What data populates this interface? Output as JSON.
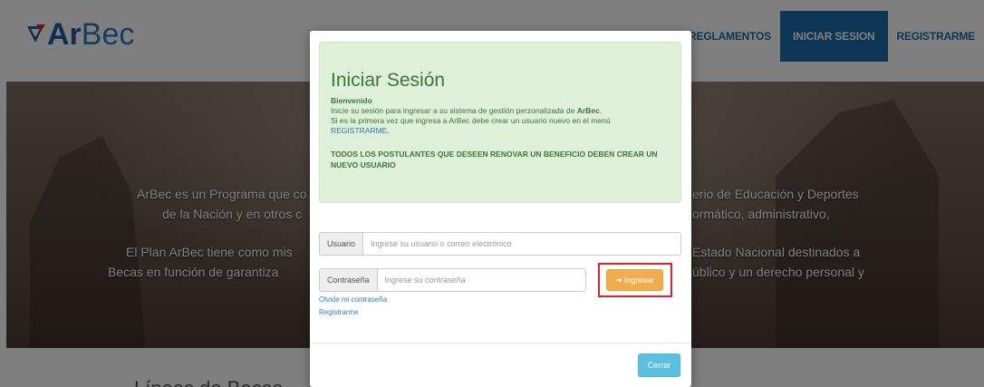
{
  "brand": {
    "name_bold": "Ar",
    "name_light": "Bec"
  },
  "nav": {
    "items": [
      {
        "label": "REGLAMENTOS",
        "icon": "book-icon"
      },
      {
        "label": "INICIAR SESION",
        "active": true
      },
      {
        "label": "REGISTRARME"
      }
    ],
    "active_color": "#1a6dab"
  },
  "hero": {
    "left_lines": [
      "ArBec es un Programa que co",
      "de la Nación y en otros c",
      "El Plan ArBec tiene como mis",
      "Becas en función de garantiza"
    ],
    "right_lines": [
      "erio de Educación y Deportes",
      "ormático, administrativo,",
      "Estado Nacional destinados a",
      "úblico y un derecho personal y"
    ]
  },
  "below": {
    "title": "Líneas de Becas"
  },
  "modal": {
    "title": "Iniciar Sesión",
    "welcome": "Bienvenido",
    "line1_prefix": "Inicie su sesión para ingresar a su sistema de gestión perzonalizada de ",
    "line1_brand": "ArBec",
    "line1_suffix": ".",
    "line2": "Si es la primera vez que ingresa a ArBec debe crear un usuario nuevo en el menú",
    "line2_link": "REGISTRARME",
    "line2_suffix": ".",
    "warning": "TODOS LOS POSTULANTES QUE DESEEN RENOVAR UN BENEFICIO DEBEN CREAR UN NUEVO USUARIO",
    "usuario_label": "Usuario",
    "usuario_placeholder": "Ingrese su usuario o correo electrónico",
    "password_label": "Contraseña",
    "password_placeholder": "Ingrese su contraseña",
    "submit_label": "Ingresar",
    "submit_icon": "sign-in-icon",
    "forgot_label": "Olvide mi contraseña",
    "register_label": "Registrarme",
    "close_label": "Cerrar",
    "colors": {
      "alert_bg": "#dff0d8",
      "submit": "#f0ad4e",
      "close": "#5bc0de",
      "highlight": "#e0202a"
    }
  }
}
